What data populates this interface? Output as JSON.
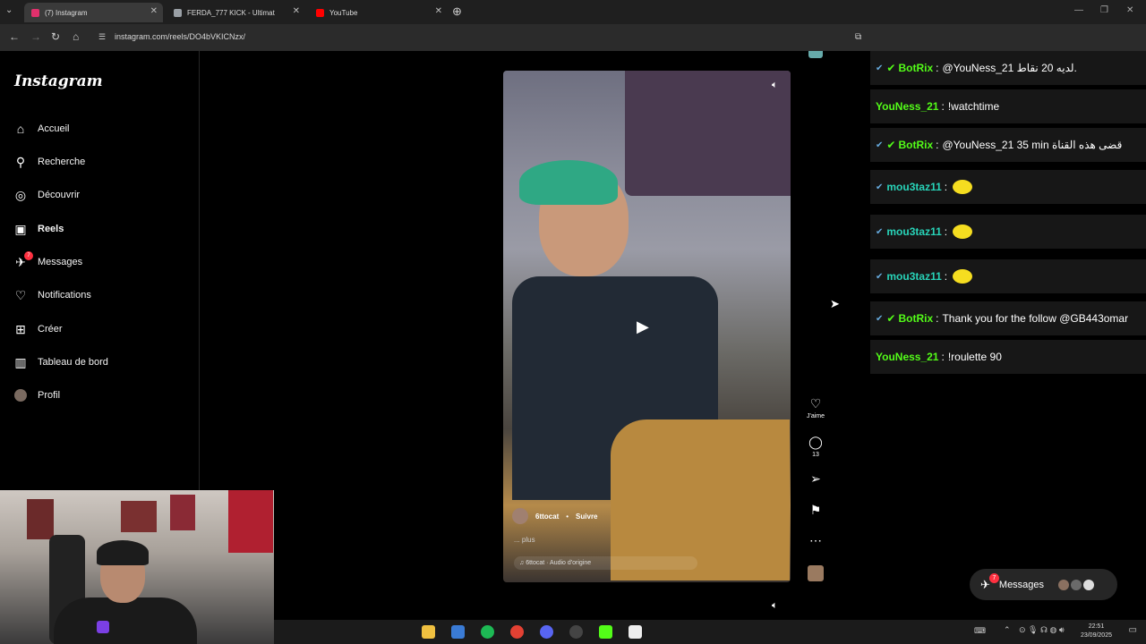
{
  "browser": {
    "tabs": [
      {
        "title": "(7) Instagram",
        "active": true,
        "favicon_color": "#e1306c"
      },
      {
        "title": "FERDA_777 KICK - Ultimat",
        "active": false,
        "favicon_color": "#9aa0a6"
      },
      {
        "title": "YouTube",
        "active": false,
        "favicon_color": "#ff0000"
      }
    ],
    "url": "instagram.com/reels/DO4bVKICNzx/"
  },
  "instagram": {
    "logo": "Instagram",
    "nav": [
      {
        "label": "Accueil",
        "icon": "home-icon",
        "glyph": "⌂"
      },
      {
        "label": "Recherche",
        "icon": "search-icon",
        "glyph": "⚲"
      },
      {
        "label": "Découvrir",
        "icon": "compass-icon",
        "glyph": "◎"
      },
      {
        "label": "Reels",
        "icon": "reels-icon",
        "glyph": "▣"
      },
      {
        "label": "Messages",
        "icon": "messenger-icon",
        "glyph": "✈",
        "badge": "7"
      },
      {
        "label": "Notifications",
        "icon": "heart-icon",
        "glyph": "♡"
      },
      {
        "label": "Créer",
        "icon": "plus-icon",
        "glyph": "⊞"
      },
      {
        "label": "Tableau de bord",
        "icon": "dashboard-icon",
        "glyph": "▥"
      },
      {
        "label": "Profil",
        "icon": "profile-avatar",
        "glyph": "●"
      }
    ],
    "reel": {
      "username": "6ttocat",
      "follow": "Suivre",
      "caption": "... plus",
      "audio": "♫ 6ttocat · Audio d'origine"
    },
    "actions": {
      "like_label": "J'aime",
      "comments_count": "13"
    },
    "messages_pill": {
      "label": "Messages",
      "badge": "7"
    }
  },
  "chat": {
    "messages": [
      {
        "user": "BotRix",
        "color": "green",
        "verified": true,
        "text": "@YouNess_21 لديه 20 نقاط."
      },
      {
        "user": "YouNess_21",
        "color": "green",
        "verified": false,
        "text": "!watchtime"
      },
      {
        "user": "BotRix",
        "color": "green",
        "verified": true,
        "text": "@YouNess_21 35 min قضى هذه القناة"
      },
      {
        "user": "mou3taz11",
        "color": "teal",
        "verified": false,
        "text": "",
        "emoji": true
      },
      {
        "user": "mou3taz11",
        "color": "teal",
        "verified": false,
        "text": "",
        "emoji": true
      },
      {
        "user": "mou3taz11",
        "color": "teal",
        "verified": false,
        "text": "",
        "emoji": true
      },
      {
        "user": "BotRix",
        "color": "green",
        "verified": true,
        "text": "Thank you for the follow @GB443omar"
      },
      {
        "user": "YouNess_21",
        "color": "green",
        "verified": false,
        "text": "!roulette 90"
      }
    ]
  },
  "taskbar": {
    "time": "22:51",
    "date": "23/09/2025"
  }
}
